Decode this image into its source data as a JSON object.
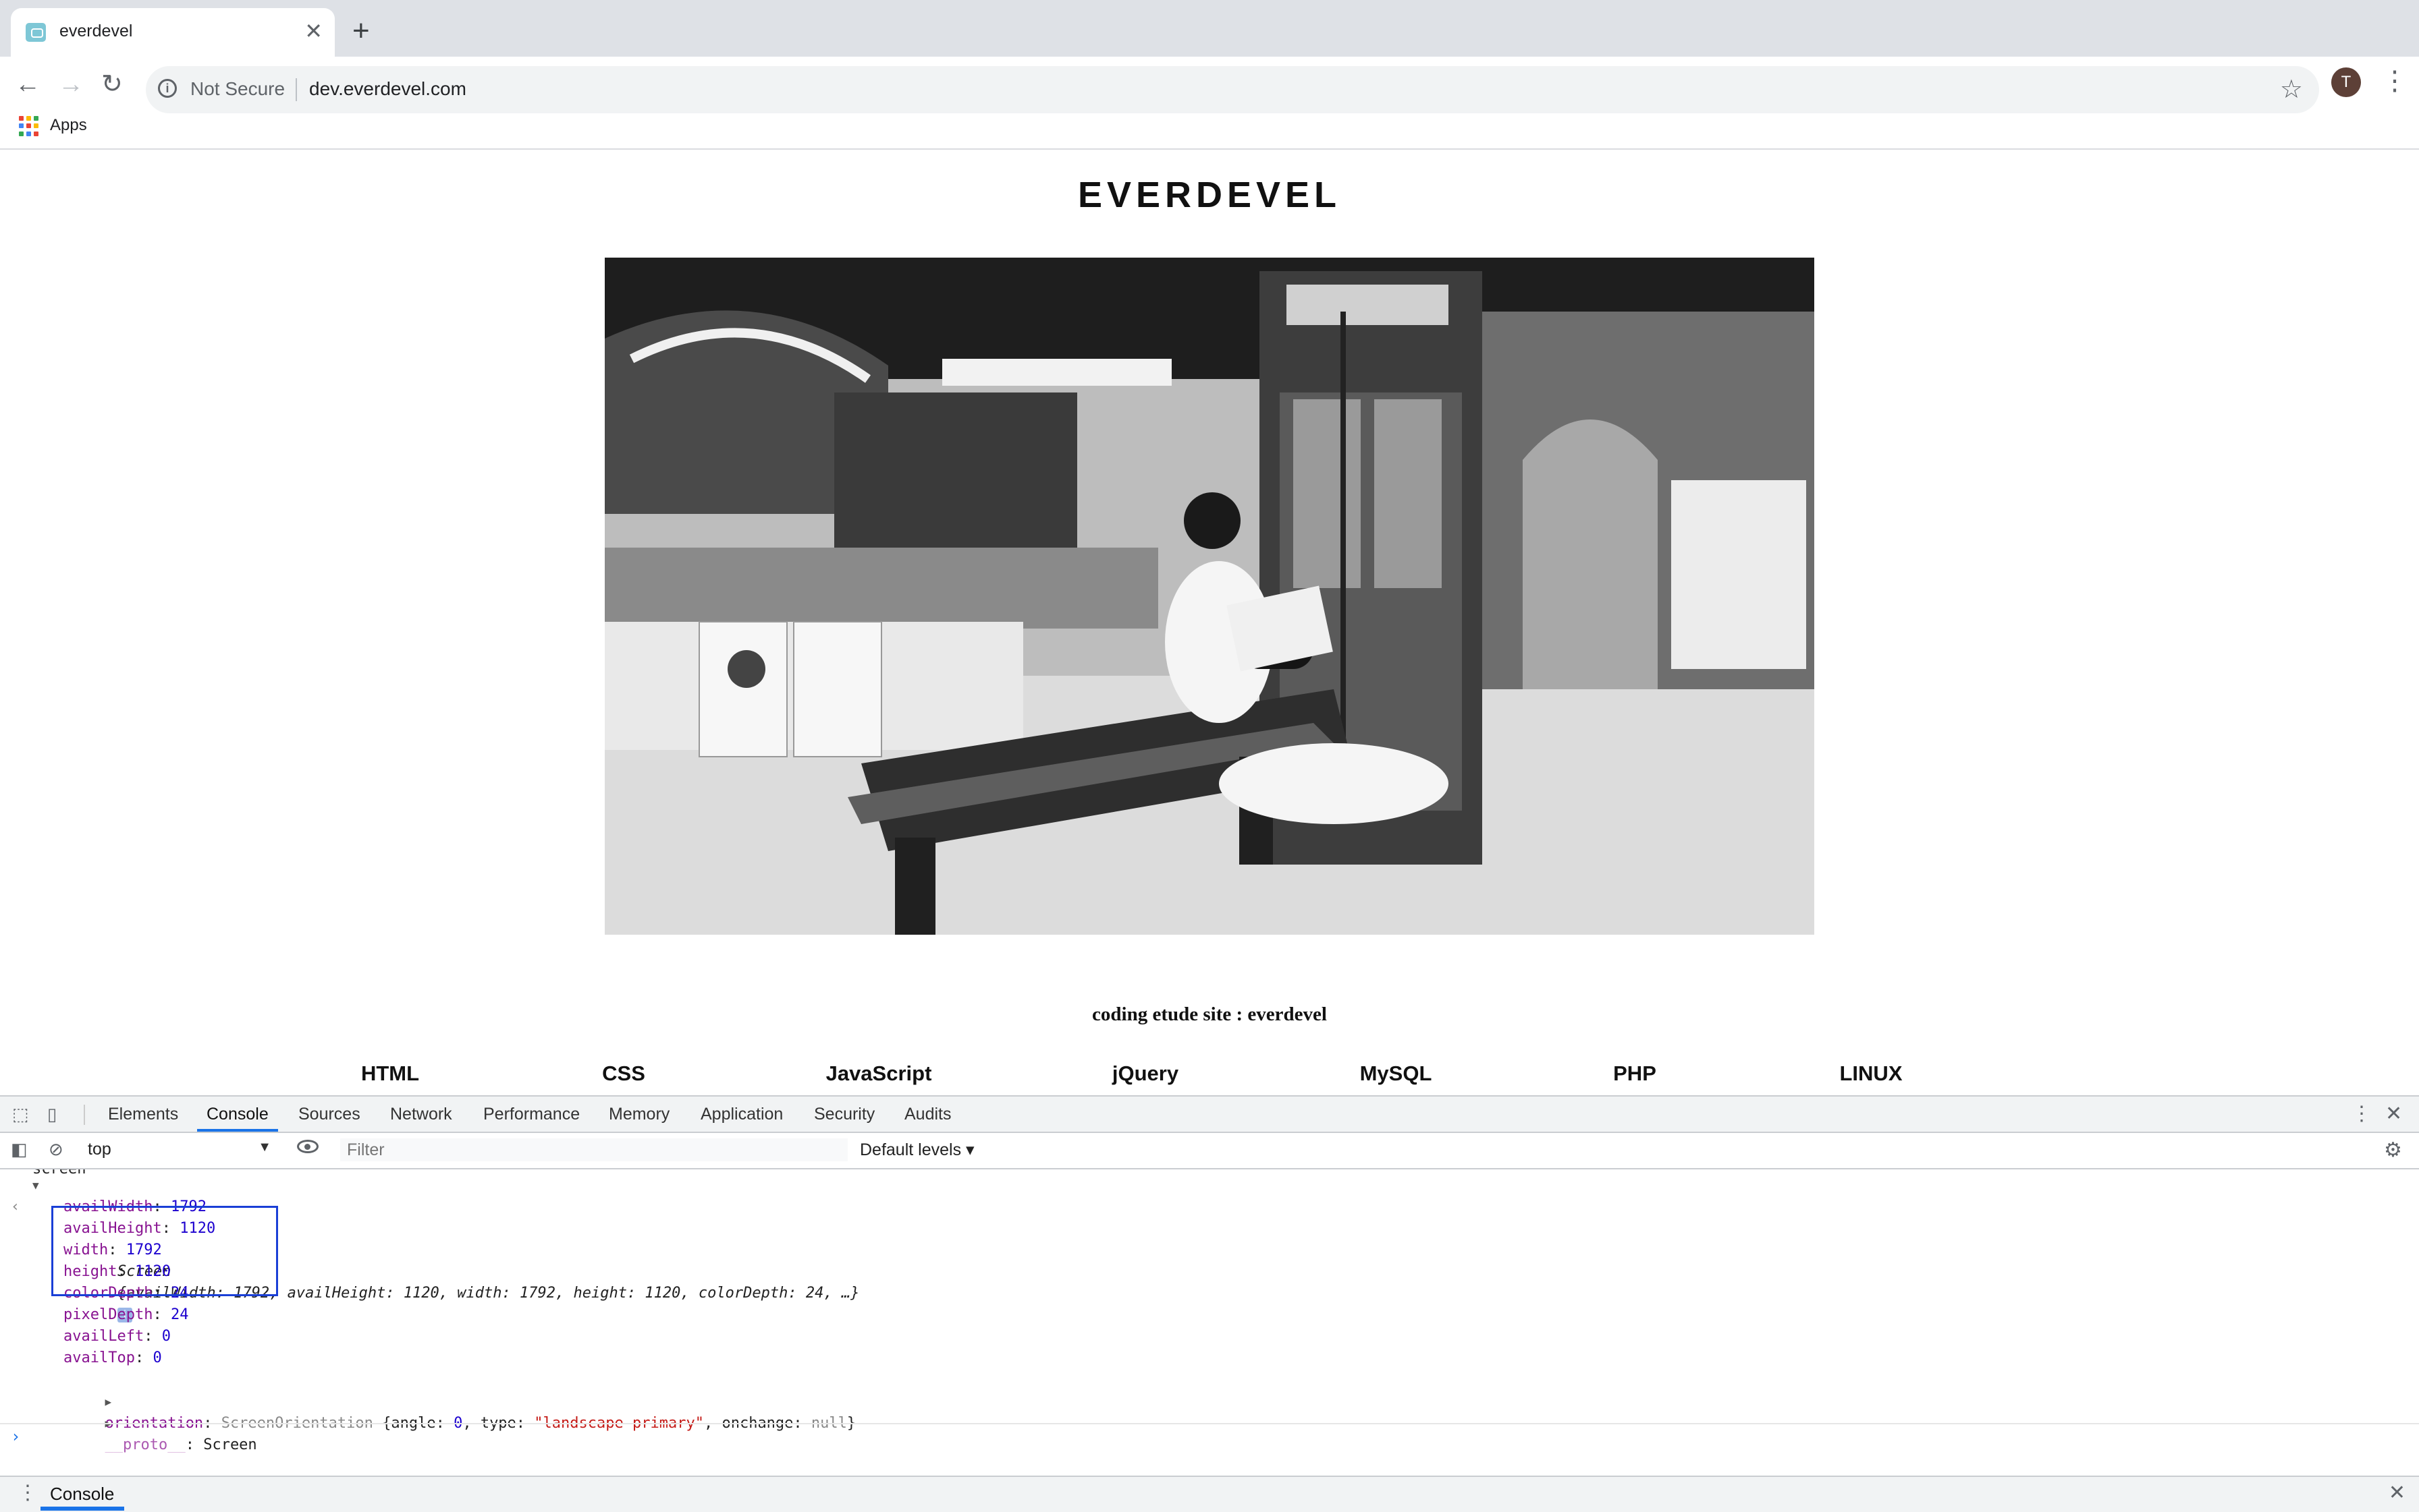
{
  "browser": {
    "tab_title": "everdevel",
    "security_label": "Not Secure",
    "url": "dev.everdevel.com",
    "avatar_initial": "T",
    "bookmarks": {
      "apps_label": "Apps"
    }
  },
  "page": {
    "site_title": "EVERDEVEL",
    "tagline": "coding etude site : everdevel",
    "nav": [
      "HTML",
      "CSS",
      "JavaScript",
      "jQuery",
      "MySQL",
      "PHP",
      "LINUX"
    ]
  },
  "devtools": {
    "tabs": [
      "Elements",
      "Console",
      "Sources",
      "Network",
      "Performance",
      "Memory",
      "Application",
      "Security",
      "Audits"
    ],
    "active_tab": "Console",
    "context": "top",
    "filter_placeholder": "Filter",
    "levels": "Default levels",
    "console": {
      "previous_command": "screen",
      "summary": {
        "object": "Screen",
        "preview": "{availWidth: 1792, availHeight: 1120, width: 1792, height: 1120, colorDepth: 24, …}"
      },
      "properties": [
        {
          "name": "availWidth",
          "value": "1792"
        },
        {
          "name": "availHeight",
          "value": "1120"
        },
        {
          "name": "width",
          "value": "1792"
        },
        {
          "name": "height",
          "value": "1120"
        },
        {
          "name": "colorDepth",
          "value": "24"
        },
        {
          "name": "pixelDepth",
          "value": "24"
        },
        {
          "name": "availLeft",
          "value": "0"
        },
        {
          "name": "availTop",
          "value": "0"
        }
      ],
      "orientation": {
        "name": "orientation",
        "type_name": "ScreenOrientation",
        "angle": "0",
        "type_value": "\"landscape-primary\"",
        "onchange": "null"
      },
      "proto": {
        "name": "__proto__",
        "value": "Screen"
      }
    },
    "drawer_tab": "Console"
  },
  "colors": {
    "accent": "#1a73e8",
    "highlight_box": "#1a3fd6",
    "prop_name": "#881391",
    "number": "#1c00cf",
    "string": "#c41a16"
  }
}
